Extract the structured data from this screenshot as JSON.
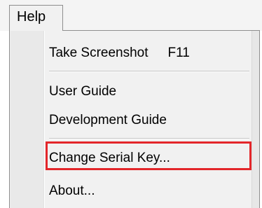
{
  "menubar": {
    "menu_title": "Help"
  },
  "dropdown": {
    "items": [
      {
        "label": "Take Screenshot",
        "shortcut": "F11"
      },
      {
        "label": "User Guide"
      },
      {
        "label": "Development Guide"
      },
      {
        "label": "Change Serial Key..."
      },
      {
        "label": "About..."
      }
    ]
  },
  "highlight": {
    "color": "#e3262a",
    "target": "Change Serial Key..."
  }
}
